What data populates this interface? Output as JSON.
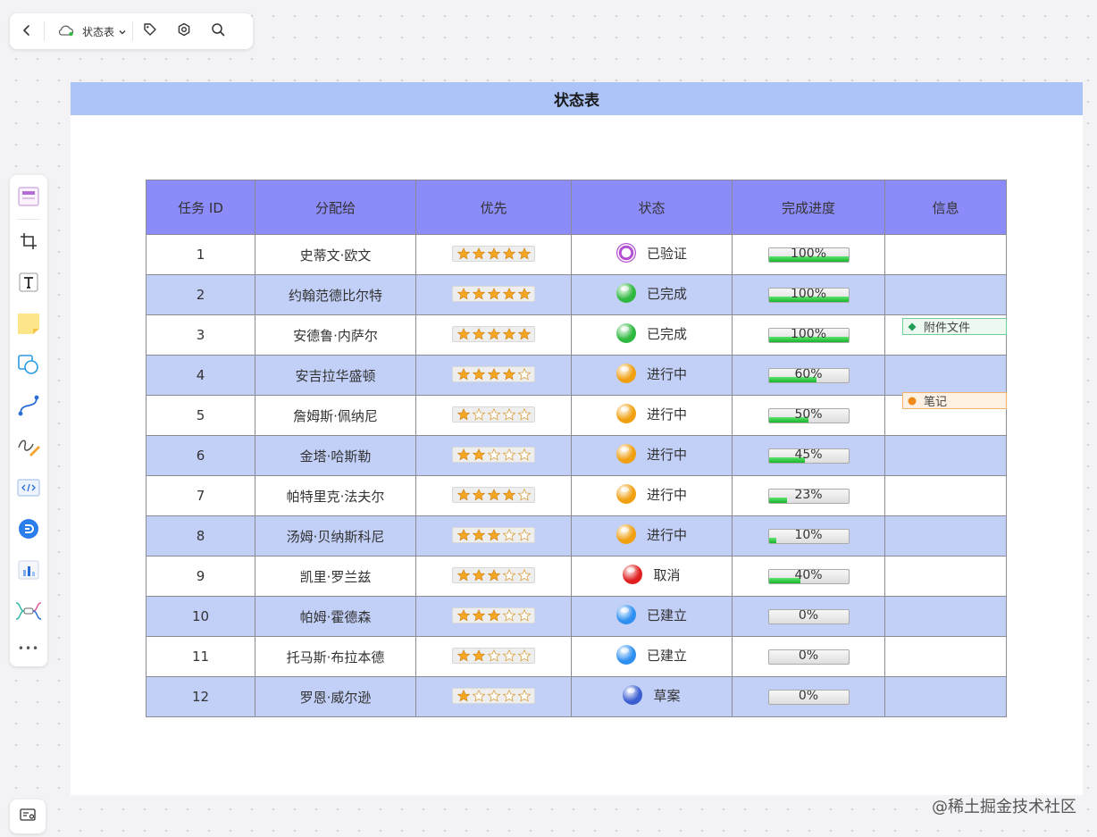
{
  "toolbar": {
    "doc_title": "状态表",
    "icons": [
      "back-icon",
      "cloud-sync-icon",
      "chevron-down-icon",
      "tag-icon",
      "settings-icon",
      "search-icon"
    ]
  },
  "leftbar": {
    "tools": [
      "frame-template-icon",
      "crop-frame-icon",
      "text-icon",
      "sticky-note-icon",
      "shapes-icon",
      "connector-icon",
      "pen-icon",
      "code-block-icon",
      "plugin-icon",
      "chart-icon",
      "mindmap-icon",
      "more-icon"
    ],
    "more_label": "•••"
  },
  "frame": {
    "title": "状态表",
    "header_color": "#adc4f8"
  },
  "table": {
    "columns": [
      "任务 ID",
      "分配给",
      "优先",
      "状态",
      "完成进度",
      "信息"
    ],
    "header_color": "#8c8bfa",
    "alt_row_color": "#c2cff7",
    "rows": [
      {
        "id": "1",
        "assignee": "史蒂文·欧文",
        "stars": 5,
        "status": "已验证",
        "status_color": "#b44fd1",
        "progress": 100,
        "progress_label": "100%"
      },
      {
        "id": "2",
        "assignee": "约翰范德比尔特",
        "stars": 5,
        "status": "已完成",
        "status_color": "#2fb83f",
        "progress": 100,
        "progress_label": "100%"
      },
      {
        "id": "3",
        "assignee": "安德鲁·内萨尔",
        "stars": 5,
        "status": "已完成",
        "status_color": "#2fb83f",
        "progress": 100,
        "progress_label": "100%"
      },
      {
        "id": "4",
        "assignee": "安吉拉华盛顿",
        "stars": 4,
        "status": "进行中",
        "status_color": "#f0a010",
        "progress": 60,
        "progress_label": "60%"
      },
      {
        "id": "5",
        "assignee": "詹姆斯·佩纳尼",
        "stars": 1,
        "status": "进行中",
        "status_color": "#f0a010",
        "progress": 50,
        "progress_label": "50%"
      },
      {
        "id": "6",
        "assignee": "金塔·哈斯勒",
        "stars": 2,
        "status": "进行中",
        "status_color": "#f0a010",
        "progress": 45,
        "progress_label": "45%"
      },
      {
        "id": "7",
        "assignee": "帕特里克·法夫尔",
        "stars": 4,
        "status": "进行中",
        "status_color": "#f0a010",
        "progress": 23,
        "progress_label": "23%"
      },
      {
        "id": "8",
        "assignee": "汤姆·贝纳斯科尼",
        "stars": 3,
        "status": "进行中",
        "status_color": "#f0a010",
        "progress": 10,
        "progress_label": "10%"
      },
      {
        "id": "9",
        "assignee": "凯里·罗兰兹",
        "stars": 3,
        "status": "取消",
        "status_color": "#e02020",
        "progress": 40,
        "progress_label": "40%"
      },
      {
        "id": "10",
        "assignee": "帕姆·霍德森",
        "stars": 3,
        "status": "已建立",
        "status_color": "#2e8ff0",
        "progress": 0,
        "progress_label": "0%"
      },
      {
        "id": "11",
        "assignee": "托马斯·布拉本德",
        "stars": 2,
        "status": "已建立",
        "status_color": "#2e8ff0",
        "progress": 0,
        "progress_label": "0%"
      },
      {
        "id": "12",
        "assignee": "罗恩·威尔逊",
        "stars": 1,
        "status": "草案",
        "status_color": "#3b5fd0",
        "progress": 0,
        "progress_label": "0%"
      }
    ]
  },
  "tags": {
    "attachment": {
      "label": "附件文件",
      "color": "#1f9d55"
    },
    "note": {
      "label": "笔记",
      "color": "#ee8a1a"
    }
  },
  "watermark": "@稀土掘金技术社区"
}
